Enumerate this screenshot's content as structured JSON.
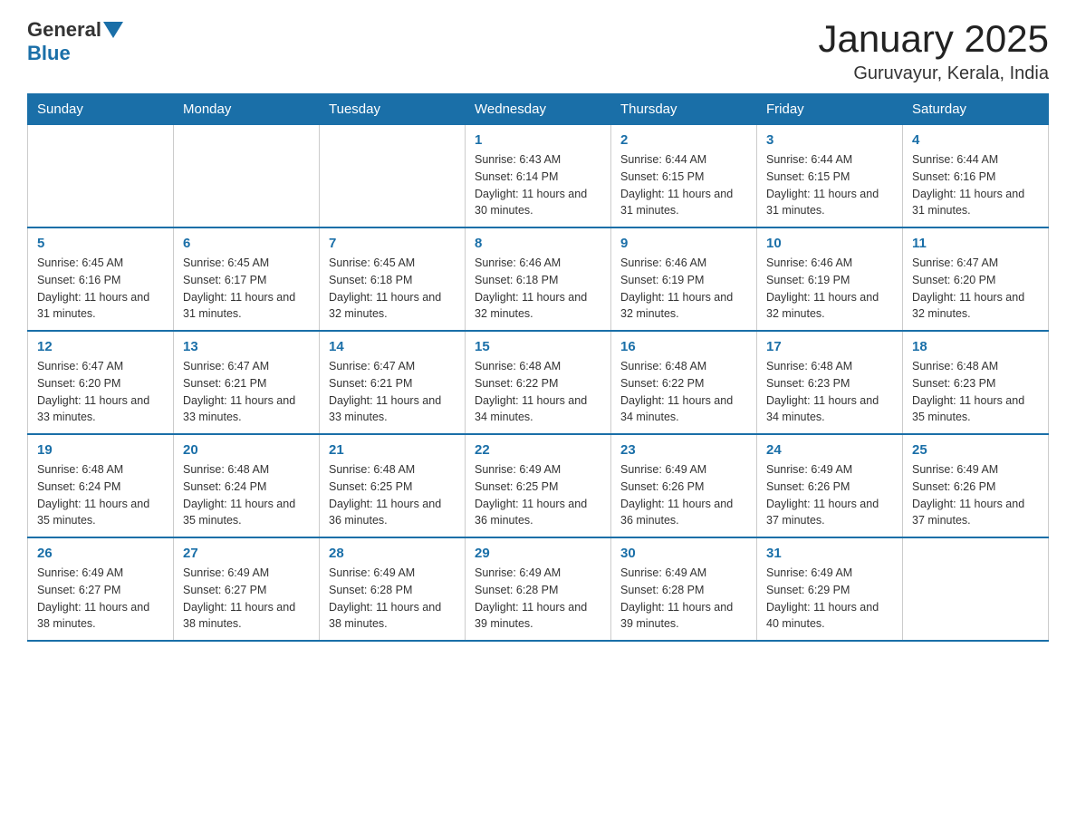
{
  "header": {
    "logo_general": "General",
    "logo_blue": "Blue",
    "title": "January 2025",
    "subtitle": "Guruvayur, Kerala, India"
  },
  "columns": [
    "Sunday",
    "Monday",
    "Tuesday",
    "Wednesday",
    "Thursday",
    "Friday",
    "Saturday"
  ],
  "weeks": [
    [
      {
        "day": "",
        "info": ""
      },
      {
        "day": "",
        "info": ""
      },
      {
        "day": "",
        "info": ""
      },
      {
        "day": "1",
        "info": "Sunrise: 6:43 AM\nSunset: 6:14 PM\nDaylight: 11 hours and 30 minutes."
      },
      {
        "day": "2",
        "info": "Sunrise: 6:44 AM\nSunset: 6:15 PM\nDaylight: 11 hours and 31 minutes."
      },
      {
        "day": "3",
        "info": "Sunrise: 6:44 AM\nSunset: 6:15 PM\nDaylight: 11 hours and 31 minutes."
      },
      {
        "day": "4",
        "info": "Sunrise: 6:44 AM\nSunset: 6:16 PM\nDaylight: 11 hours and 31 minutes."
      }
    ],
    [
      {
        "day": "5",
        "info": "Sunrise: 6:45 AM\nSunset: 6:16 PM\nDaylight: 11 hours and 31 minutes."
      },
      {
        "day": "6",
        "info": "Sunrise: 6:45 AM\nSunset: 6:17 PM\nDaylight: 11 hours and 31 minutes."
      },
      {
        "day": "7",
        "info": "Sunrise: 6:45 AM\nSunset: 6:18 PM\nDaylight: 11 hours and 32 minutes."
      },
      {
        "day": "8",
        "info": "Sunrise: 6:46 AM\nSunset: 6:18 PM\nDaylight: 11 hours and 32 minutes."
      },
      {
        "day": "9",
        "info": "Sunrise: 6:46 AM\nSunset: 6:19 PM\nDaylight: 11 hours and 32 minutes."
      },
      {
        "day": "10",
        "info": "Sunrise: 6:46 AM\nSunset: 6:19 PM\nDaylight: 11 hours and 32 minutes."
      },
      {
        "day": "11",
        "info": "Sunrise: 6:47 AM\nSunset: 6:20 PM\nDaylight: 11 hours and 32 minutes."
      }
    ],
    [
      {
        "day": "12",
        "info": "Sunrise: 6:47 AM\nSunset: 6:20 PM\nDaylight: 11 hours and 33 minutes."
      },
      {
        "day": "13",
        "info": "Sunrise: 6:47 AM\nSunset: 6:21 PM\nDaylight: 11 hours and 33 minutes."
      },
      {
        "day": "14",
        "info": "Sunrise: 6:47 AM\nSunset: 6:21 PM\nDaylight: 11 hours and 33 minutes."
      },
      {
        "day": "15",
        "info": "Sunrise: 6:48 AM\nSunset: 6:22 PM\nDaylight: 11 hours and 34 minutes."
      },
      {
        "day": "16",
        "info": "Sunrise: 6:48 AM\nSunset: 6:22 PM\nDaylight: 11 hours and 34 minutes."
      },
      {
        "day": "17",
        "info": "Sunrise: 6:48 AM\nSunset: 6:23 PM\nDaylight: 11 hours and 34 minutes."
      },
      {
        "day": "18",
        "info": "Sunrise: 6:48 AM\nSunset: 6:23 PM\nDaylight: 11 hours and 35 minutes."
      }
    ],
    [
      {
        "day": "19",
        "info": "Sunrise: 6:48 AM\nSunset: 6:24 PM\nDaylight: 11 hours and 35 minutes."
      },
      {
        "day": "20",
        "info": "Sunrise: 6:48 AM\nSunset: 6:24 PM\nDaylight: 11 hours and 35 minutes."
      },
      {
        "day": "21",
        "info": "Sunrise: 6:48 AM\nSunset: 6:25 PM\nDaylight: 11 hours and 36 minutes."
      },
      {
        "day": "22",
        "info": "Sunrise: 6:49 AM\nSunset: 6:25 PM\nDaylight: 11 hours and 36 minutes."
      },
      {
        "day": "23",
        "info": "Sunrise: 6:49 AM\nSunset: 6:26 PM\nDaylight: 11 hours and 36 minutes."
      },
      {
        "day": "24",
        "info": "Sunrise: 6:49 AM\nSunset: 6:26 PM\nDaylight: 11 hours and 37 minutes."
      },
      {
        "day": "25",
        "info": "Sunrise: 6:49 AM\nSunset: 6:26 PM\nDaylight: 11 hours and 37 minutes."
      }
    ],
    [
      {
        "day": "26",
        "info": "Sunrise: 6:49 AM\nSunset: 6:27 PM\nDaylight: 11 hours and 38 minutes."
      },
      {
        "day": "27",
        "info": "Sunrise: 6:49 AM\nSunset: 6:27 PM\nDaylight: 11 hours and 38 minutes."
      },
      {
        "day": "28",
        "info": "Sunrise: 6:49 AM\nSunset: 6:28 PM\nDaylight: 11 hours and 38 minutes."
      },
      {
        "day": "29",
        "info": "Sunrise: 6:49 AM\nSunset: 6:28 PM\nDaylight: 11 hours and 39 minutes."
      },
      {
        "day": "30",
        "info": "Sunrise: 6:49 AM\nSunset: 6:28 PM\nDaylight: 11 hours and 39 minutes."
      },
      {
        "day": "31",
        "info": "Sunrise: 6:49 AM\nSunset: 6:29 PM\nDaylight: 11 hours and 40 minutes."
      },
      {
        "day": "",
        "info": ""
      }
    ]
  ]
}
